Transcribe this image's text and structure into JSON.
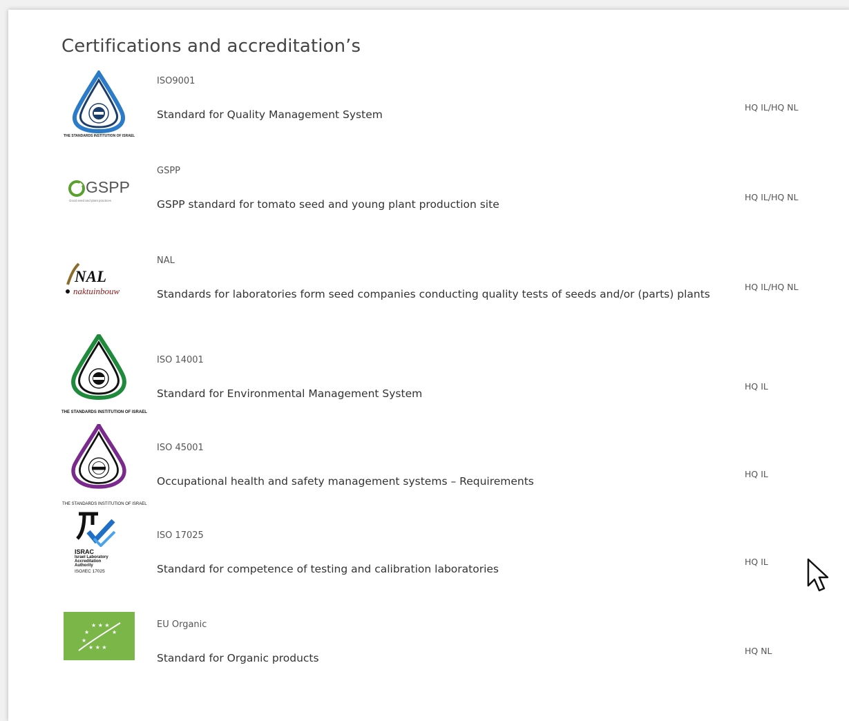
{
  "page": {
    "title": "Certifications and accreditation’s"
  },
  "certifications": [
    {
      "code": "ISO9001",
      "description": "Standard for Quality Management System",
      "location": "HQ IL/HQ NL",
      "logo_icon": "sii-iso9001-logo",
      "logo_text": "THE STANDARDS INSTITUTION OF ISRAEL",
      "accent": "#2b7bc8"
    },
    {
      "code": "GSPP",
      "description": "GSPP standard for tomato seed and young plant production site",
      "location": "HQ IL/HQ NL",
      "logo_icon": "gspp-logo",
      "logo_text": "GSPP",
      "logo_subtext": "Good seed and plant practices",
      "accent": "#5aa02c"
    },
    {
      "code": "NAL",
      "description": "Standards for laboratories form seed companies conducting quality tests of seeds and/or (parts) plants",
      "location": "HQ IL/HQ NL",
      "logo_icon": "naktuinbouw-nal-logo",
      "logo_text": "NAL",
      "logo_subtext": "naktuinbouw",
      "accent": "#8b1a1a"
    },
    {
      "code": "ISO 14001",
      "description": "Standard for Environmental Management System",
      "location": "HQ IL",
      "logo_icon": "sii-iso14001-logo",
      "logo_text": "THE STANDARDS INSTITUTION OF ISRAEL",
      "accent": "#1f8a3b"
    },
    {
      "code": "ISO 45001",
      "description": "Occupational health and safety management systems – Requirements",
      "location": "HQ IL",
      "logo_icon": "sii-iso45001-logo",
      "logo_text": "THE STANDARDS INSTITUTION OF ISRAEL",
      "accent": "#7a2a8c"
    },
    {
      "code": "ISO 17025",
      "description": "Standard for competence of testing and calibration laboratories",
      "location": "HQ IL",
      "logo_icon": "israc-logo",
      "logo_text": "ISRAC",
      "logo_subtext": "Israel Laboratory Accreditation Authority",
      "logo_subtext2": "ISO/IEC 17025",
      "accent": "#1f6fc7"
    },
    {
      "code": "EU Organic",
      "description": "Standard for Organic products",
      "location": "HQ NL",
      "logo_icon": "eu-organic-logo",
      "accent": "#7ab648"
    }
  ]
}
